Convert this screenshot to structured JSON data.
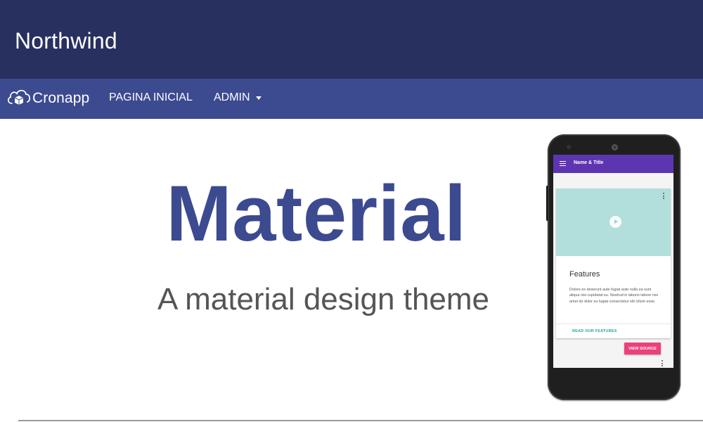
{
  "header": {
    "app_title": "Northwind"
  },
  "navbar": {
    "brand_label": "Cronapp",
    "brand_icon": "cloud-box-icon",
    "items": [
      {
        "label": "PAGINA INICIAL"
      },
      {
        "label": "ADMIN",
        "has_dropdown": true
      }
    ]
  },
  "hero": {
    "title": "Material",
    "subtitle": "A material design theme"
  },
  "phone_screen": {
    "app_bar_title": "Name & Title",
    "card": {
      "title": "Features",
      "text": "Dolore ex deserunt aute fugiat aute nulla ea sunt aliqua nisi cupidatat eu. Nostrud in laboris labore nisi amet do dolor eu fugiat consectetur elit cillum esse.",
      "action_label": "READ OUR FEATURES"
    },
    "button_label": "VIEW SOURCE"
  },
  "colors": {
    "header_bg": "#283060",
    "navbar_bg": "#3c4a90",
    "hero_title": "#3c4a90",
    "hero_subtitle": "#555555",
    "phone_app_bar": "#5e35b1",
    "phone_media": "#b2dfdb",
    "phone_button": "#ec407a",
    "phone_action": "#26a69a"
  }
}
